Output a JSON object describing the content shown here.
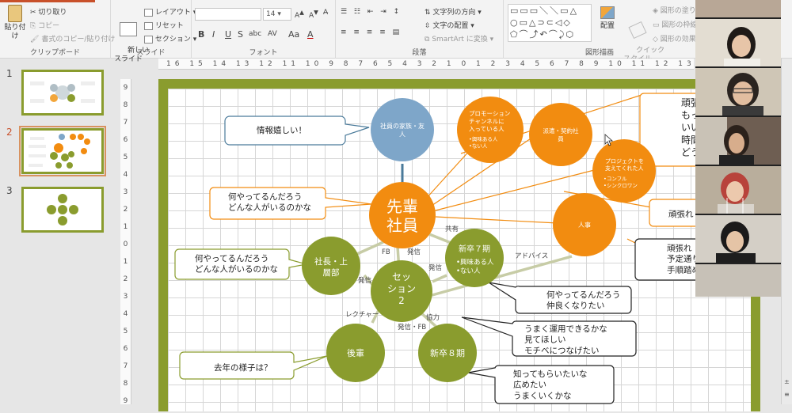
{
  "ribbon": {
    "clipboard": {
      "paste": "貼り付け",
      "cut": "切り取り",
      "copy": "コピー",
      "format_painter": "書式のコピー/貼り付け",
      "label": "クリップボード"
    },
    "slides": {
      "new_slide": "新しい\nスライド",
      "layout": "レイアウト",
      "reset": "リセット",
      "section": "セクション",
      "label": "スライド"
    },
    "font": {
      "size": "14",
      "bold": "B",
      "italic": "I",
      "underline": "U",
      "strike": "S",
      "shadow": "abc",
      "spacing": "AV",
      "case": "Aa",
      "color": "A",
      "label": "フォント"
    },
    "paragraph": {
      "text_direction": "文字列の方向",
      "align_text": "文字の配置",
      "smartart": "SmartArt に変換",
      "label": "段落"
    },
    "drawing": {
      "arrange": "配置",
      "quick_styles": "クイック\nスタイル",
      "fill": "図形の塗り",
      "outline": "図形の枠線",
      "effects": "図形の効果",
      "label": "図形描画"
    }
  },
  "thumbnails": [
    {
      "number": "1",
      "active": false
    },
    {
      "number": "2",
      "active": true
    },
    {
      "number": "3",
      "active": false
    }
  ],
  "ruler": {
    "horizontal": "16 15 14 13 12 11 10 9 8 7 6 5 4 3 2 1 0 1 2 3 4 5 6 7 8 9 10 11 12 13 14 15 16",
    "vertical": [
      "9",
      "8",
      "7",
      "6",
      "5",
      "4",
      "3",
      "2",
      "1",
      "0",
      "1",
      "2",
      "3",
      "4",
      "5",
      "6",
      "7",
      "8",
      "9"
    ]
  },
  "scroll_icons": [
    "±",
    "≡"
  ],
  "diagram": {
    "nodes": {
      "senpai": "先輩\n社員",
      "session2": "セッ\nション\n2",
      "president": "社長・上\n層部",
      "shinsotsu7": "新卒７期",
      "shinsotsu7_notes": [
        "•興味ある人",
        "•ない人"
      ],
      "kouhai": "後輩",
      "shinsotsu8": "新卒８期",
      "family": "社員の家族・友\n人",
      "promotion": "プロモーション\nチャンネルに\n入っている人",
      "promotion_notes": [
        "•興味ある人",
        "•ない人"
      ],
      "haken": "派遣・契約社\n員",
      "project": "プロジェクトを\n支えてくれた人",
      "project_notes": [
        "•コンフル",
        "•シンクロワン"
      ],
      "jinji": "人事"
    },
    "edge_labels": {
      "kyoyu": "共有",
      "fb": "FB",
      "hasshin1": "発信",
      "hasshin2": "発信",
      "hasshin3": "発信",
      "advice": "アドバイス",
      "lecture": "レクチャー",
      "kyoryoku": "協力",
      "hasshin_fb": "発信・FB"
    },
    "callouts": {
      "info": "情報嬉しい！",
      "senpai_q": "何やってるんだろう\nどんな人がいるのかな",
      "president_q": "何やってるんだろう\nどんな人がいるのかな",
      "kouhai_q": "去年の様子は？",
      "shinsotsu7_q": "何やってるんだろう\n仲良くなりたい",
      "unyou": "うまく運用できるかな\n見てほしい\nモチベにつなげたい",
      "shinsotsu8_q": "知ってもらいたいな\n広めたい\nうまくいくかな",
      "right_top": "頑張れ\nもっと\nいい\n時間が\nどうで",
      "right_mid": "頑張れ",
      "right_bottom": "頑張れ\n予定通り進\n手順踏めて"
    }
  },
  "colors": {
    "orange": "#f28c10",
    "olive": "#8a9c2e",
    "blue": "#7ea6c9",
    "accent": "#c8502a"
  },
  "video_participants": [
    "participant-1",
    "participant-2",
    "participant-3",
    "participant-4",
    "participant-5",
    "participant-6"
  ]
}
